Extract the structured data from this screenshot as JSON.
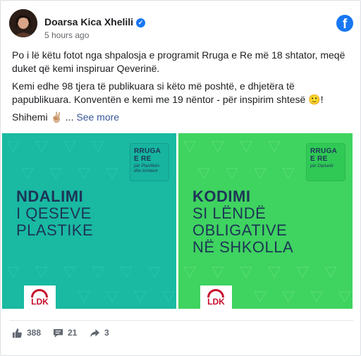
{
  "post": {
    "author": "Doarsa Kica Xhelili",
    "time": "5 hours ago",
    "paragraphs": [
      "Po i lë këtu fotot nga shpalosja e programit Rruga e Re më 18 shtator, meqë duket që kemi inspiruar Qeverinë.",
      "Kemi edhe 98 tjera të publikuara si këto më poshtë, e dhjetëra të papublikuara. Konventën e kemi me 19 nëntor - për inspirim shtesë 🙂!"
    ],
    "last_line": "Shihemi ✌🏼 ...",
    "see_more": "See more"
  },
  "images": {
    "left": {
      "badge_title": "RRUGA\nE RE",
      "badge_sub": "për Planifikim dhe Ambient",
      "heading_bold": "NDALIMI",
      "heading_rest": [
        "I QESEVE",
        "PLASTIKE"
      ],
      "logo": "LDK"
    },
    "right": {
      "badge_title": "RRUGA\nE RE",
      "badge_sub": "për Dijetarët",
      "heading_bold": "KODIMI",
      "heading_rest": [
        "SI LËNDË",
        "OBLIGATIVE",
        "NË SHKOLLA"
      ],
      "logo": "LDK"
    }
  },
  "actions": {
    "likes": "388",
    "comments": "21",
    "shares": "3"
  },
  "colors": {
    "left_panel": "#19b9a2",
    "right_panel": "#3fd360",
    "accent": "#1877f2"
  },
  "icons": [
    "verified-badge-icon",
    "facebook-logo-icon",
    "like-icon",
    "comment-icon",
    "share-icon"
  ]
}
